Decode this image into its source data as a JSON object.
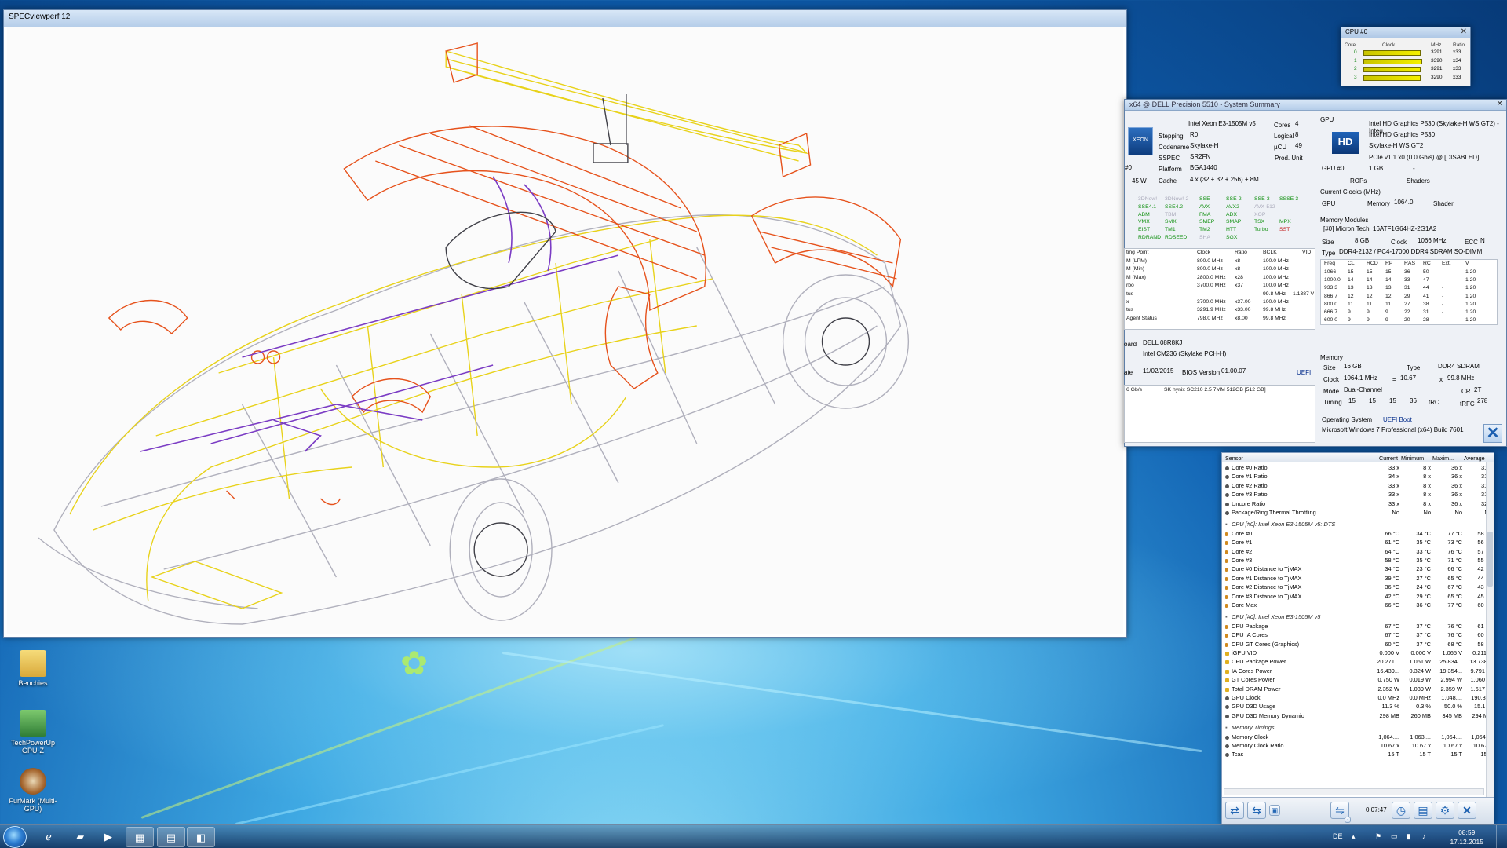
{
  "spec_window": {
    "title": "SPECviewperf 12"
  },
  "summary": {
    "title": "x64 @ DELL Precision 5510 - System Summary",
    "cpu_name": "Intel Xeon E3-1505M v5",
    "cores_label": "Cores",
    "cores": "4",
    "stepping_label": "Stepping",
    "stepping": "R0",
    "logical_label": "Logical",
    "logical": "8",
    "codename_label": "Codename",
    "codename": "Skylake-H",
    "ucu_label": "µCU",
    "ucu": "49",
    "sspec_label": "SSPEC",
    "sspec": "SR2FN",
    "prod_unit": "Prod. Unit",
    "platform_label": "Platform",
    "platform": "BGA1440",
    "cache_label": "Cache",
    "cache": "4 x (32 + 32 + 256) + 8M",
    "cpu_select": "#0",
    "tdp": "45 W",
    "features": [
      [
        "3DNow!",
        "3DNow!-2",
        "SSE",
        "SSE-2",
        "SSE-3",
        "SSSE-3"
      ],
      [
        "SSE4.1",
        "SSE4.2",
        "AVX",
        "AVX2",
        "AVX-512",
        ""
      ],
      [
        "ABM",
        "TBM",
        "FMA",
        "ADX",
        "XOP",
        ""
      ],
      [
        "VMX",
        "SMX",
        "SMEP",
        "SMAP",
        "TSX",
        "MPX"
      ],
      [
        "EIST",
        "TM1",
        "TM2",
        "HTT",
        "Turbo",
        "SST"
      ],
      [
        "RDRAND",
        "RDSEED",
        "SHA",
        "SGX",
        "",
        ""
      ]
    ],
    "op_header": [
      "ting Point",
      "Clock",
      "Ratio",
      "BCLK",
      "VID"
    ],
    "op_rows": [
      [
        "M (LPM)",
        "800.0 MHz",
        "x8",
        "100.0 MHz",
        ""
      ],
      [
        "M (Min)",
        "800.0 MHz",
        "x8",
        "100.0 MHz",
        ""
      ],
      [
        "M (Max)",
        "2800.0 MHz",
        "x28",
        "100.0 MHz",
        ""
      ],
      [
        "rbo",
        "3700.0 MHz",
        "x37",
        "100.0 MHz",
        ""
      ],
      [
        "tus",
        "-",
        "-",
        "99.8 MHz",
        "1.1387 V"
      ],
      [
        "x",
        "3700.0 MHz",
        "x37.00",
        "100.0 MHz",
        ""
      ],
      [
        "tus",
        "3291.9 MHz",
        "x33.00",
        "99.8 MHz",
        ""
      ],
      [
        " Agent Status",
        "798.0 MHz",
        "x8.00",
        "99.8 MHz",
        ""
      ]
    ],
    "mb_label": "oard",
    "mb": "DELL 08R8KJ",
    "chipset": "Intel CM236 (Skylake PCH-H)",
    "bios_date_label": "ate",
    "bios_date": "11/02/2015",
    "bios_ver_label": "BIOS Version",
    "bios_ver": "01.00.07",
    "uefi": "UEFI",
    "drive_iface": "6 Gb/s",
    "drive": "SK hynix SC210 2.5 7MM 512GB [512 GB]",
    "gpu_label": "GPU",
    "gpu_name": "Intel HD Graphics P530 (Skylake-H WS GT2) - Integ",
    "gpu_name2": "Intel HD Graphics P530",
    "gpu_code": "Skylake-H WS GT2",
    "gpu_bus": "PCIe v1.1 x0 (0.0 Gb/s) @ [DISABLED]",
    "gpu_select": "GPU #0",
    "gpu_mem": "1 GB",
    "rops": "ROPs",
    "shaders": "Shaders",
    "dash": "-",
    "clocks_label": "Current Clocks (MHz)",
    "gpu_clk_label": "GPU",
    "mem_clk_label": "Memory",
    "mem_clk": "1064.0",
    "shader_clk_label": "Shader",
    "modules_label": "Memory Modules",
    "module_sel": "[#0] Micron Tech. 16ATF1G64HZ-2G1A2",
    "size_label": "Size",
    "mod_size": "8 GB",
    "mod_clock_label": "Clock",
    "mod_clock": "1066 MHz",
    "ecc_label": "ECC",
    "ecc": "N",
    "type_label": "Type",
    "mod_type": "DDR4-2132 / PC4-17000 DDR4 SDRAM SO-DIMM",
    "timing_header": [
      "Freq",
      "CL",
      "RCD",
      "RP",
      "RAS",
      "RC",
      "Ext.",
      "V"
    ],
    "timing_rows": [
      [
        "1066",
        "15",
        "15",
        "15",
        "36",
        "50",
        "-",
        "1.20"
      ],
      [
        "1000.0",
        "14",
        "14",
        "14",
        "33",
        "47",
        "-",
        "1.20"
      ],
      [
        "933.3",
        "13",
        "13",
        "13",
        "31",
        "44",
        "-",
        "1.20"
      ],
      [
        "866.7",
        "12",
        "12",
        "12",
        "29",
        "41",
        "-",
        "1.20"
      ],
      [
        "800.0",
        "11",
        "11",
        "11",
        "27",
        "38",
        "-",
        "1.20"
      ],
      [
        "666.7",
        "9",
        "9",
        "9",
        "22",
        "31",
        "-",
        "1.20"
      ],
      [
        "600.0",
        "9",
        "9",
        "9",
        "20",
        "28",
        "-",
        "1.20"
      ]
    ],
    "memory_label": "Memory",
    "mem_size": "16 GB",
    "mem_type": "DDR4 SDRAM",
    "clock_label": "Clock",
    "mem_clock": "1064.1 MHz",
    "eq": "=",
    "mem_ratio": "10.67",
    "xsym": "x",
    "mem_bclk": "99.8 MHz",
    "mode_label": "Mode",
    "mem_mode": "Dual-Channel",
    "cr_label": "CR",
    "mem_cr": "2T",
    "timing_label": "Timing",
    "t1": "15",
    "t2": "15",
    "t3": "15",
    "t4": "36",
    "trc_label": "tRC",
    "trfc_label": "tRFC",
    "trfc": "278",
    "os_label": "Operating System",
    "boot": "UEFI Boot",
    "os": "Microsoft Windows 7 Professional (x64) Build 7601"
  },
  "cpu_widget": {
    "title": "CPU #0",
    "h_core": "Core",
    "h_clock": "Clock",
    "h_mhz": "MHz",
    "h_ratio": "Ratio",
    "rows": [
      {
        "core": "0",
        "mhz": "3291",
        "ratio": "x33",
        "level": 0.89
      },
      {
        "core": "1",
        "mhz": "3390",
        "ratio": "x34",
        "level": 0.92
      },
      {
        "core": "2",
        "mhz": "3291",
        "ratio": "x33",
        "level": 0.89
      },
      {
        "core": "3",
        "mhz": "3290",
        "ratio": "x33",
        "level": 0.89
      }
    ]
  },
  "sensors": {
    "headers": [
      "Sensor",
      "Current",
      "Minimum",
      "Maxim...",
      "Average"
    ],
    "rows": [
      {
        "k": "v",
        "n": "Core #0 Ratio",
        "c": "33 x",
        "mn": "8 x",
        "mx": "36 x",
        "av": "31 x"
      },
      {
        "k": "v",
        "n": "Core #1 Ratio",
        "c": "34 x",
        "mn": "8 x",
        "mx": "36 x",
        "av": "31 x"
      },
      {
        "k": "v",
        "n": "Core #2 Ratio",
        "c": "33 x",
        "mn": "8 x",
        "mx": "36 x",
        "av": "31 x"
      },
      {
        "k": "v",
        "n": "Core #3 Ratio",
        "c": "33 x",
        "mn": "8 x",
        "mx": "36 x",
        "av": "31 x"
      },
      {
        "k": "v",
        "n": "Uncore Ratio",
        "c": "33 x",
        "mn": "8 x",
        "mx": "36 x",
        "av": "32 x"
      },
      {
        "k": "v",
        "n": "Package/Ring Thermal Throttling",
        "c": "No",
        "mn": "No",
        "mx": "No",
        "av": "No"
      },
      {
        "k": "s",
        "n": ""
      },
      {
        "k": "g",
        "n": "CPU [#0]: Intel Xeon E3-1505M v5: DTS"
      },
      {
        "k": "t",
        "n": "Core #0",
        "c": "66 °C",
        "mn": "34 °C",
        "mx": "77 °C",
        "av": "58 °C"
      },
      {
        "k": "t",
        "n": "Core #1",
        "c": "61 °C",
        "mn": "35 °C",
        "mx": "73 °C",
        "av": "56 °C"
      },
      {
        "k": "t",
        "n": "Core #2",
        "c": "64 °C",
        "mn": "33 °C",
        "mx": "76 °C",
        "av": "57 °C"
      },
      {
        "k": "t",
        "n": "Core #3",
        "c": "58 °C",
        "mn": "35 °C",
        "mx": "71 °C",
        "av": "55 °C"
      },
      {
        "k": "t",
        "n": "Core #0 Distance to TjMAX",
        "c": "34 °C",
        "mn": "23 °C",
        "mx": "66 °C",
        "av": "42 °C"
      },
      {
        "k": "t",
        "n": "Core #1 Distance to TjMAX",
        "c": "39 °C",
        "mn": "27 °C",
        "mx": "65 °C",
        "av": "44 °C"
      },
      {
        "k": "t",
        "n": "Core #2 Distance to TjMAX",
        "c": "36 °C",
        "mn": "24 °C",
        "mx": "67 °C",
        "av": "43 °C"
      },
      {
        "k": "t",
        "n": "Core #3 Distance to TjMAX",
        "c": "42 °C",
        "mn": "29 °C",
        "mx": "65 °C",
        "av": "45 °C"
      },
      {
        "k": "t",
        "n": "Core Max",
        "c": "66 °C",
        "mn": "36 °C",
        "mx": "77 °C",
        "av": "60 °C"
      },
      {
        "k": "s",
        "n": ""
      },
      {
        "k": "g",
        "n": "CPU [#0]: Intel Xeon E3-1505M v5"
      },
      {
        "k": "t",
        "n": "CPU Package",
        "c": "67 °C",
        "mn": "37 °C",
        "mx": "76 °C",
        "av": "61 °C"
      },
      {
        "k": "t",
        "n": "CPU IA Cores",
        "c": "67 °C",
        "mn": "37 °C",
        "mx": "76 °C",
        "av": "60 °C"
      },
      {
        "k": "t",
        "n": "CPU GT Cores (Graphics)",
        "c": "60 °C",
        "mn": "37 °C",
        "mx": "68 °C",
        "av": "58 °C"
      },
      {
        "k": "p",
        "n": "iGPU VID",
        "c": "0.000 V",
        "mn": "0.000 V",
        "mx": "1.065 V",
        "av": "0.211 V"
      },
      {
        "k": "p",
        "n": "CPU Package Power",
        "c": "20.271...",
        "mn": "1.061 W",
        "mx": "25.834...",
        "av": "13.738..."
      },
      {
        "k": "p",
        "n": "IA Cores Power",
        "c": "16.439...",
        "mn": "0.324 W",
        "mx": "19.354...",
        "av": "9.791 W"
      },
      {
        "k": "p",
        "n": "GT Cores Power",
        "c": "0.750 W",
        "mn": "0.019 W",
        "mx": "2.994 W",
        "av": "1.060 W"
      },
      {
        "k": "p",
        "n": "Total DRAM Power",
        "c": "2.352 W",
        "mn": "1.039 W",
        "mx": "2.359 W",
        "av": "1.617 W"
      },
      {
        "k": "v",
        "n": "GPU Clock",
        "c": "0.0 MHz",
        "mn": "0.0 MHz",
        "mx": "1,048....",
        "av": "190.3 ..."
      },
      {
        "k": "v",
        "n": "GPU D3D Usage",
        "c": "11.3 %",
        "mn": "0.3 %",
        "mx": "50.0 %",
        "av": "15.1 %"
      },
      {
        "k": "v",
        "n": "GPU D3D Memory Dynamic",
        "c": "298 MB",
        "mn": "260 MB",
        "mx": "345 MB",
        "av": "294 MB"
      },
      {
        "k": "s",
        "n": ""
      },
      {
        "k": "g",
        "n": "Memory Timings"
      },
      {
        "k": "v",
        "n": "Memory Clock",
        "c": "1,064....",
        "mn": "1,063....",
        "mx": "1,064....",
        "av": "1,064...."
      },
      {
        "k": "v",
        "n": "Memory Clock Ratio",
        "c": "10.67 x",
        "mn": "10.67 x",
        "mx": "10.67 x",
        "av": "10.67 x"
      },
      {
        "k": "v",
        "n": "Tcas",
        "c": "15 T",
        "mn": "15 T",
        "mx": "15 T",
        "av": "15 T"
      }
    ],
    "elapsed": "0:07:47"
  },
  "desktop_icons": [
    {
      "label": "Benchies",
      "color": "#f2c94c"
    },
    {
      "label": "TechPowerUp GPU-Z",
      "color": "#4aa547"
    },
    {
      "label": "FurMark (Multi-GPU)",
      "color": "#b07a3a"
    }
  ],
  "wallpaper_logo": "✿",
  "taskbar": {
    "time": "08:59",
    "date": "17.12.2015",
    "lang": "DE"
  }
}
